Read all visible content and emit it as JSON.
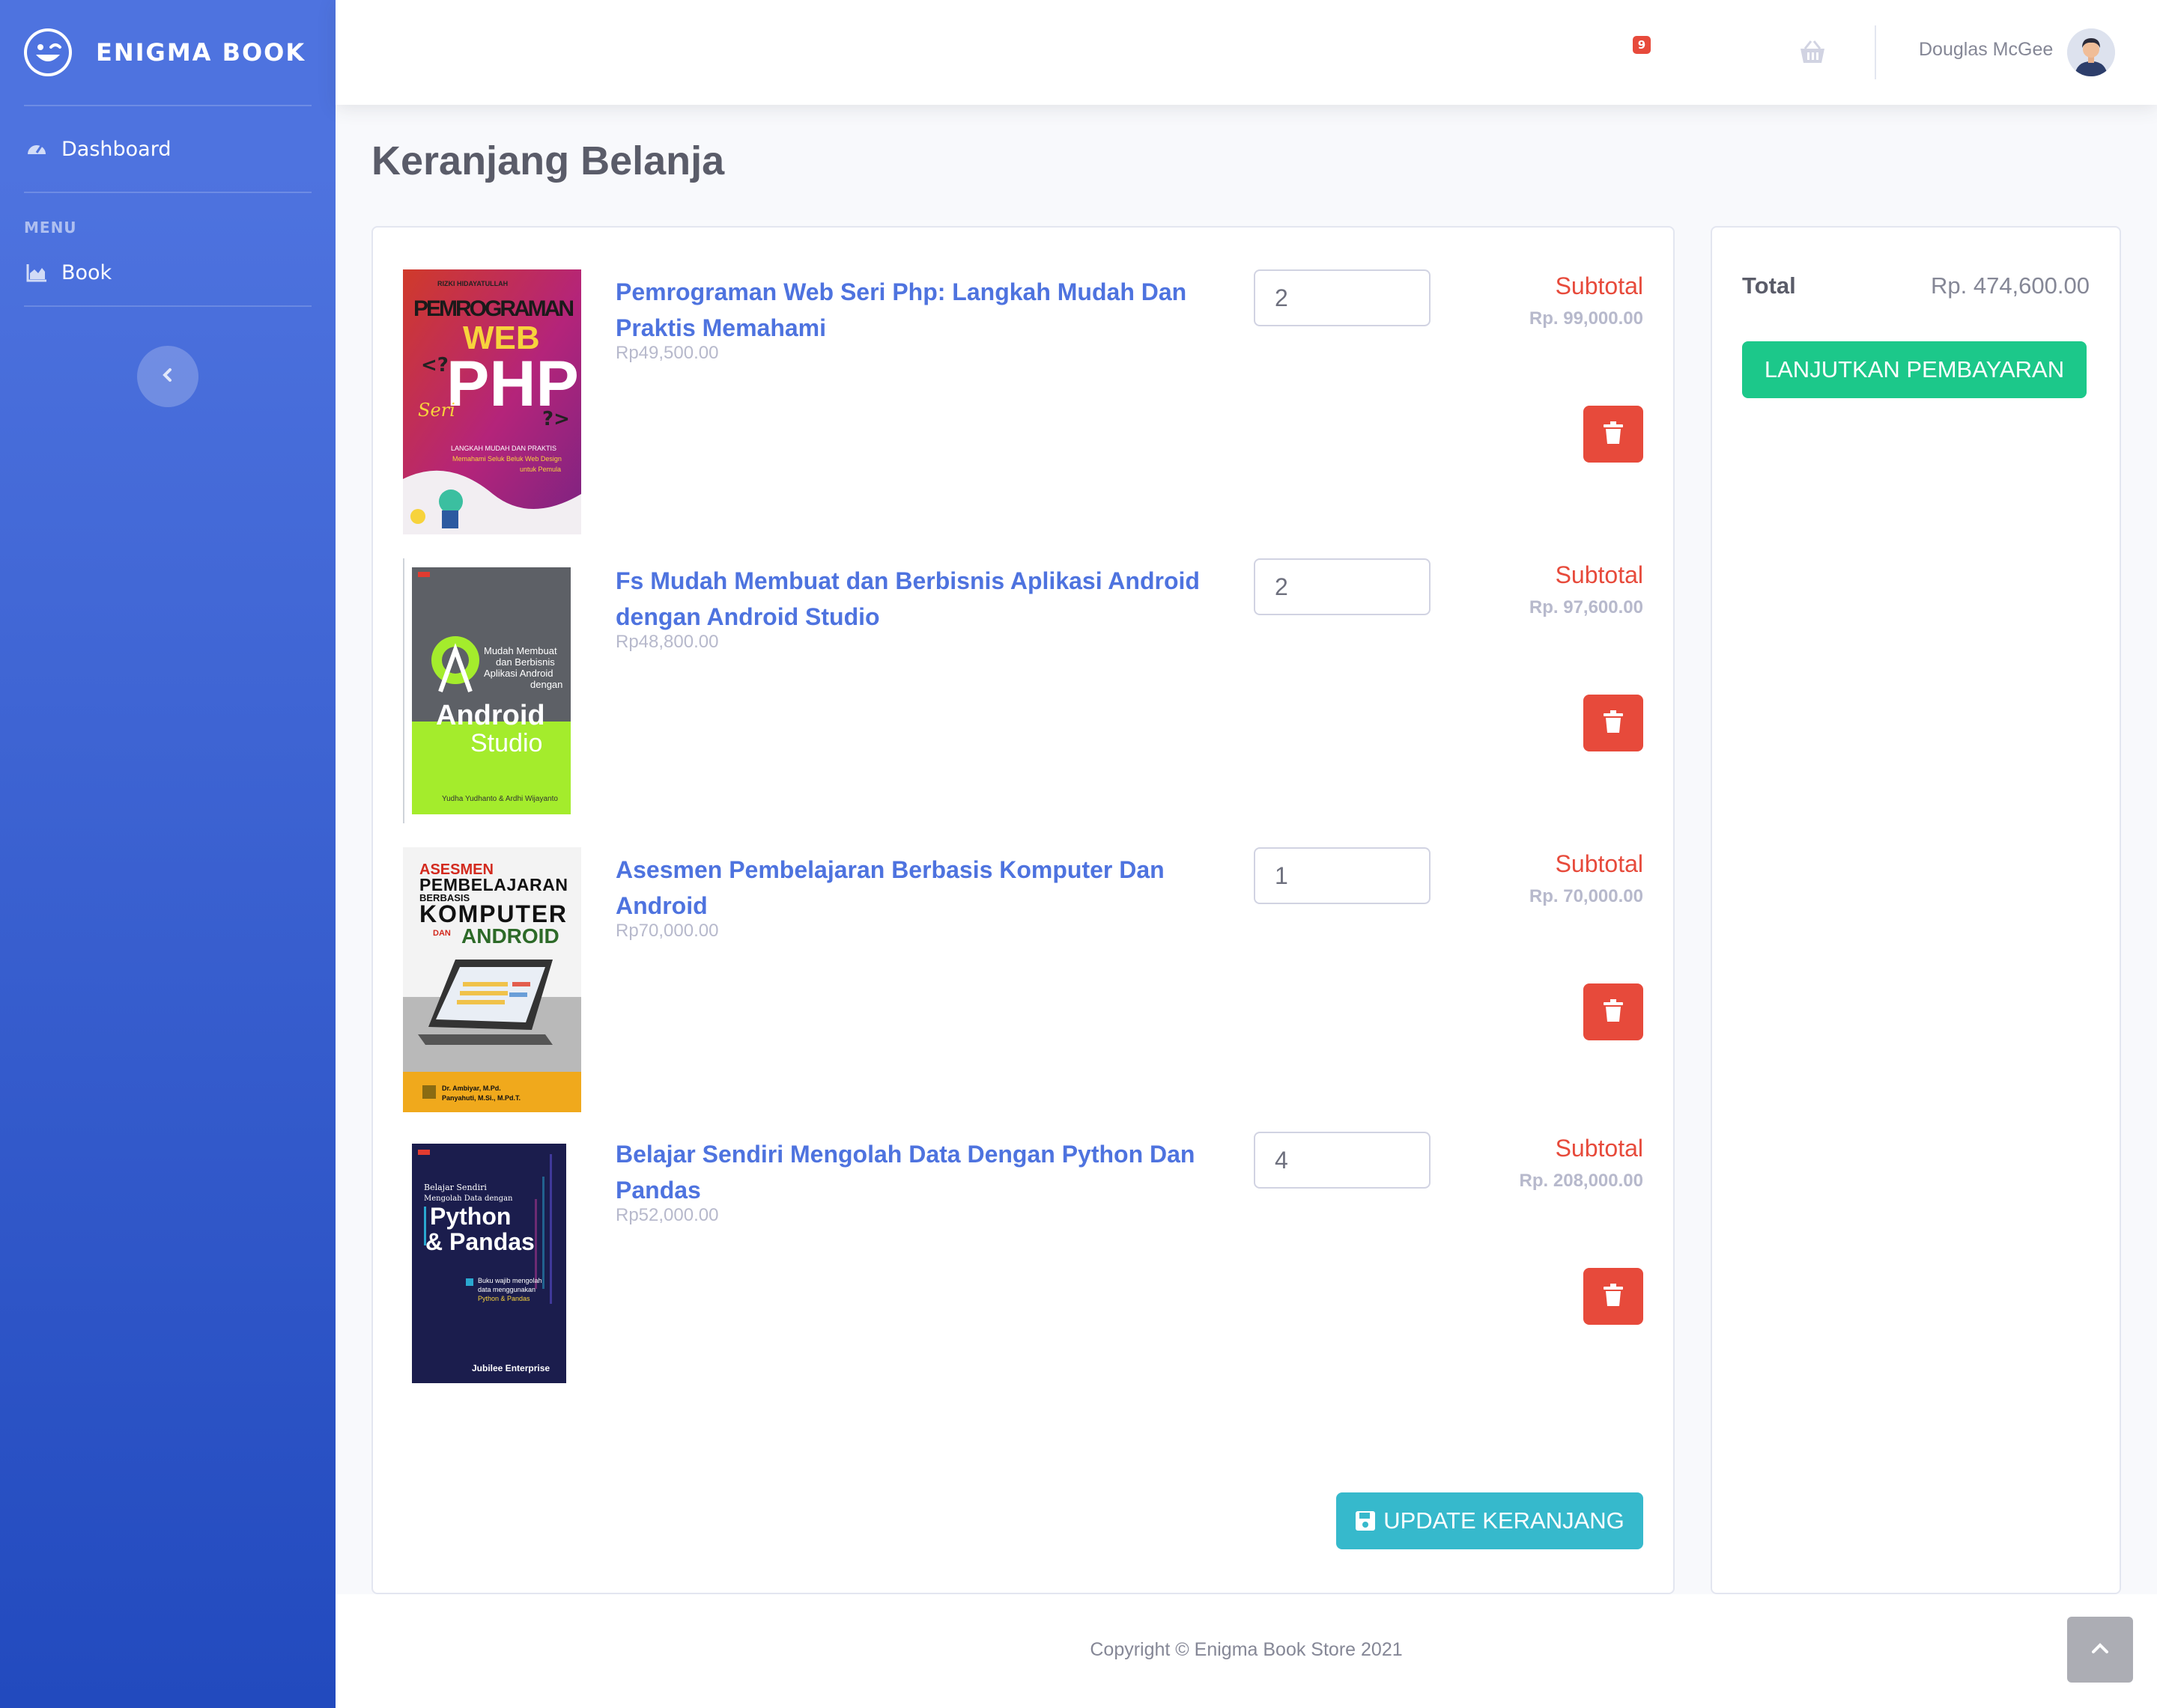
{
  "brand": {
    "name": "ENIGMA BOOK"
  },
  "sidebar": {
    "items": [
      {
        "label": "Dashboard",
        "icon": "tachometer-icon"
      },
      {
        "label": "Book",
        "icon": "chart-area-icon"
      }
    ],
    "heading": "MENU"
  },
  "topbar": {
    "cart_count": "9",
    "user_name": "Douglas McGee"
  },
  "page": {
    "title": "Keranjang Belanja"
  },
  "cart": {
    "subtotal_label": "Subtotal",
    "items": [
      {
        "title": "Pemrograman Web Seri Php: Langkah Mudah Dan Praktis Memahami",
        "price": "Rp49,500.00",
        "qty": "2",
        "subtotal": "Rp. 99,000.00"
      },
      {
        "title": "Fs Mudah Membuat dan Berbisnis Aplikasi Android dengan Android Studio",
        "price": "Rp48,800.00",
        "qty": "2",
        "subtotal": "Rp. 97,600.00"
      },
      {
        "title": "Asesmen Pembelajaran Berbasis Komputer Dan Android",
        "price": "Rp70,000.00",
        "qty": "1",
        "subtotal": "Rp. 70,000.00"
      },
      {
        "title": "Belajar Sendiri Mengolah Data Dengan Python Dan Pandas",
        "price": "Rp52,000.00",
        "qty": "4",
        "subtotal": "Rp. 208,000.00"
      }
    ],
    "update_label": "UPDATE KERANJANG"
  },
  "covers": {
    "php": {
      "author": "RIZKI HIDAYATULLAH",
      "line1": "PEMROGRAMAN",
      "line2": "WEB",
      "line3": "PHP",
      "seri": "Seri",
      "sub1": "LANGKAH MUDAH DAN PRAKTIS",
      "sub2": "Memahami Seluk Beluk Web Design",
      "sub3": "untuk Pemula"
    },
    "android": {
      "sub1": "Mudah Membuat",
      "sub2": "dan Berbisnis",
      "sub3": "Aplikasi Android",
      "sub4": "dengan",
      "big1": "Android",
      "big2": "Studio",
      "authors": "Yudha Yudhanto & Ardhi Wijayanto"
    },
    "asesmen": {
      "l1": "ASESMEN",
      "l2": "PEMBELAJARAN",
      "l3": "BERBASIS",
      "l4": "KOMPUTER",
      "l5": "DAN",
      "l6": "ANDROID",
      "a1": "Dr. Ambiyar, M.Pd.",
      "a2": "Panyahuti, M.Si., M.Pd.T."
    },
    "python": {
      "s1": "Belajar Sendiri",
      "s2": "Mengolah Data dengan",
      "big1": "Python",
      "big2": "& Pandas",
      "n1": "Buku wajib mengolah",
      "n2": "data menggunakan",
      "n3": "Python & Pandas",
      "pub": "Jubilee Enterprise"
    }
  },
  "summary": {
    "total_label": "Total",
    "total_value": "Rp. 474,600.00",
    "checkout_label": "LANJUTKAN PEMBAYARAN"
  },
  "footer": {
    "copyright": "Copyright © Enigma Book Store 2021"
  },
  "colors": {
    "primary": "#4e73df",
    "danger": "#e74a3b",
    "success": "#1cc88a",
    "info": "#36b9cc"
  }
}
